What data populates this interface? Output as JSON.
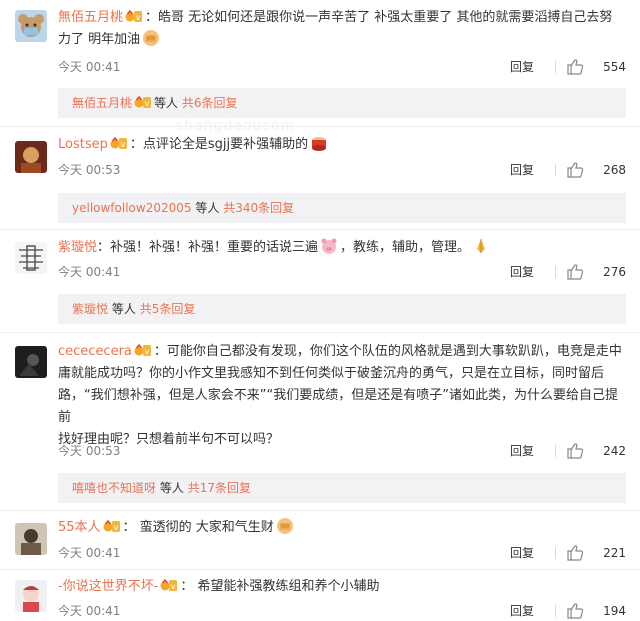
{
  "watermark": "shangdaoucom",
  "comments": [
    {
      "user": "無佰五月桃",
      "text_line1": "皓哥 无论如何还是跟你说一声辛苦了 补强太重要了 其他的就需要滔搏自己去努",
      "text_line2": "力了 明年加油",
      "time": "今天 00:41",
      "reply_label": "回复",
      "likes": "554",
      "replies_user": "無佰五月桃",
      "replies_mid": "等人",
      "replies_count": "共6条回复"
    },
    {
      "user": "Lostsep",
      "text_line1": "：点评论全是sgjj要补强辅助的",
      "time": "今天 00:53",
      "reply_label": "回复",
      "likes": "268",
      "replies_user": "yellowfollow202005",
      "replies_mid": "等人",
      "replies_count": "共340条回复"
    },
    {
      "user": "紫璇悦",
      "text_line1": "：补强！补强！补强！重要的话说三遍",
      "text_line1b": "，教练，辅助，管理。",
      "time": "今天 00:41",
      "reply_label": "回复",
      "likes": "276",
      "replies_user": "紫璇悦",
      "replies_mid": "等人",
      "replies_count": "共5条回复"
    },
    {
      "user": "cecececera",
      "text_line1": "：可能你自己都没有发现，你们这个队伍的风格就是遇到大事软趴趴，电竞是走中",
      "text_line2": "庸就能成功吗？你的小作文里我感知不到任何类似于破釜沉舟的勇气，只是在立目标，同时留后",
      "text_line3": "路，“我们想补强，但是人家会不来”“我们要成绩，但是还是有喷子”诸如此类，为什么要给自己提前",
      "text_line4": "找好理由呢？只想着前半句不可以吗？",
      "time": "今天 00:53",
      "reply_label": "回复",
      "likes": "242",
      "replies_user": "嘻嘻也不知道呀",
      "replies_mid": "等人",
      "replies_count": "共17条回复"
    },
    {
      "user": "55本人",
      "text_line1": "： 蛮透彻的 大家和气生财",
      "time": "今天 00:41",
      "reply_label": "回复",
      "likes": "221"
    },
    {
      "user": "-你说这世界不坏-",
      "text_line1": "： 希望能补强教练组和养个小辅助",
      "time": "今天 00:41",
      "reply_label": "回复",
      "likes": "194"
    }
  ]
}
